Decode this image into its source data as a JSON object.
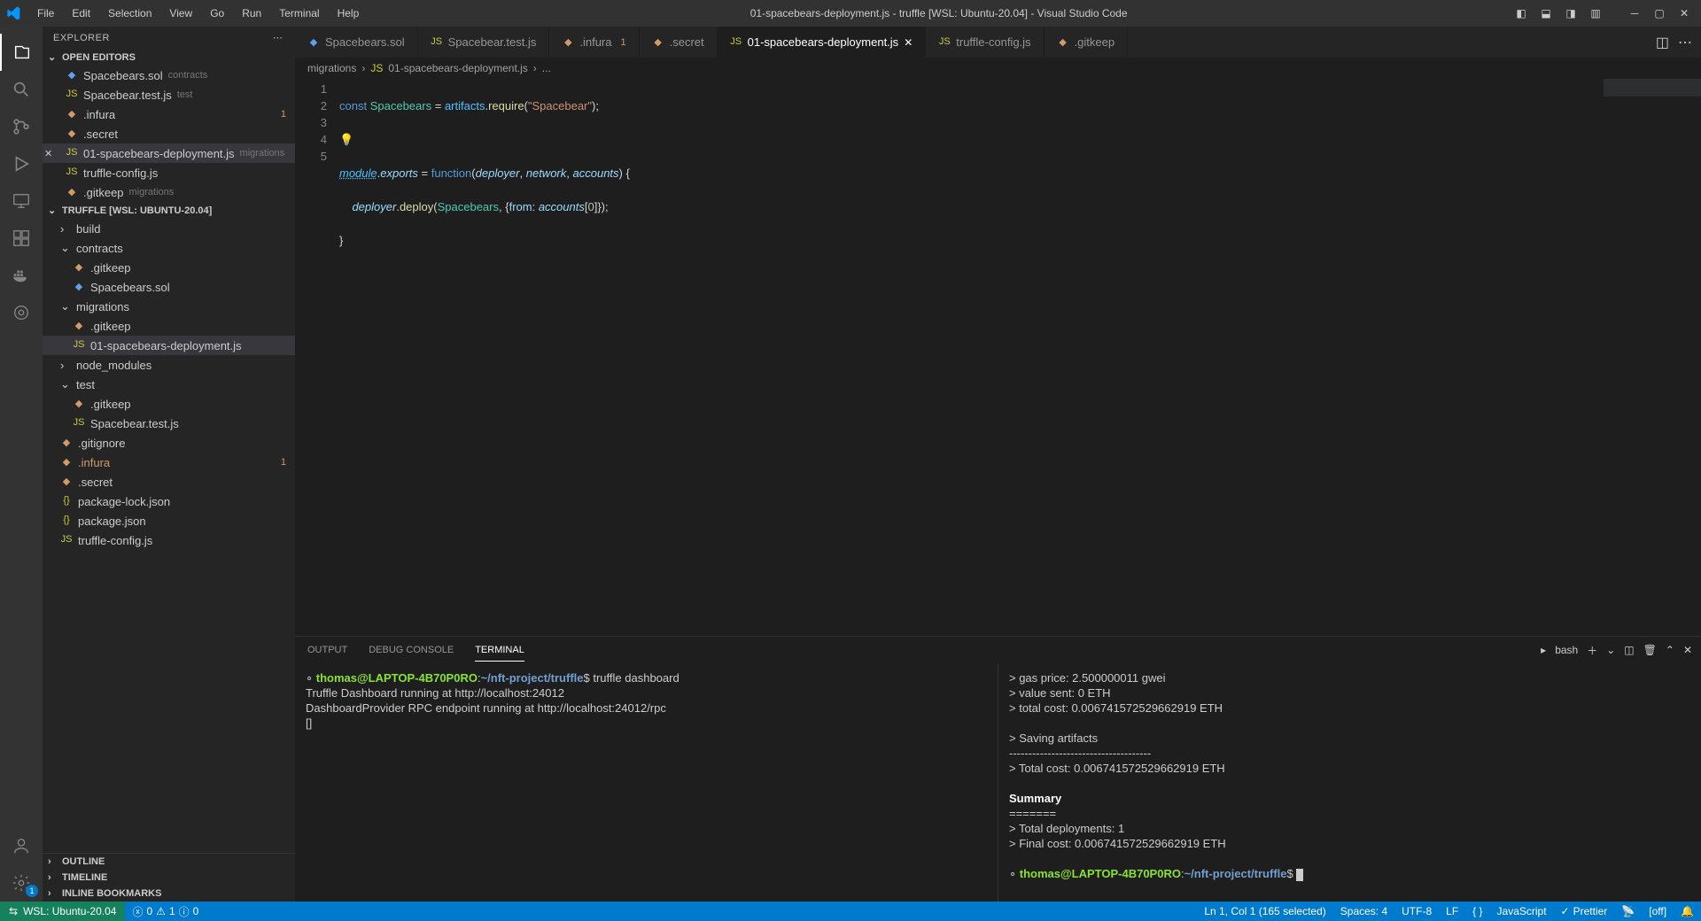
{
  "titlebar": {
    "menus": [
      "File",
      "Edit",
      "Selection",
      "View",
      "Go",
      "Run",
      "Terminal",
      "Help"
    ],
    "title": "01-spacebears-deployment.js - truffle [WSL: Ubuntu-20.04] - Visual Studio Code"
  },
  "sidebar": {
    "header": "EXPLORER",
    "open_editors_label": "OPEN EDITORS",
    "open_editors": [
      {
        "name": "Spacebears.sol",
        "hint": "contracts",
        "icon": "sol"
      },
      {
        "name": "Spacebear.test.js",
        "hint": "test",
        "icon": "js"
      },
      {
        "name": ".infura",
        "hint": "",
        "icon": "mod",
        "badge": "1"
      },
      {
        "name": ".secret",
        "hint": "",
        "icon": "mod"
      },
      {
        "name": "01-spacebears-deployment.js",
        "hint": "migrations",
        "icon": "js",
        "close": true,
        "sel": true
      },
      {
        "name": "truffle-config.js",
        "hint": "",
        "icon": "js"
      },
      {
        "name": ".gitkeep",
        "hint": "migrations",
        "icon": "mod"
      }
    ],
    "workspace_label": "TRUFFLE [WSL: UBUNTU-20.04]",
    "tree": [
      {
        "t": "folder",
        "name": "build",
        "depth": 1,
        "open": false
      },
      {
        "t": "folder",
        "name": "contracts",
        "depth": 1,
        "open": true
      },
      {
        "t": "file",
        "name": ".gitkeep",
        "depth": 2,
        "icon": "mod"
      },
      {
        "t": "file",
        "name": "Spacebears.sol",
        "depth": 2,
        "icon": "sol"
      },
      {
        "t": "folder",
        "name": "migrations",
        "depth": 1,
        "open": true
      },
      {
        "t": "file",
        "name": ".gitkeep",
        "depth": 2,
        "icon": "mod"
      },
      {
        "t": "file",
        "name": "01-spacebears-deployment.js",
        "depth": 2,
        "icon": "js",
        "sel": true
      },
      {
        "t": "folder",
        "name": "node_modules",
        "depth": 1,
        "open": false
      },
      {
        "t": "folder",
        "name": "test",
        "depth": 1,
        "open": true
      },
      {
        "t": "file",
        "name": ".gitkeep",
        "depth": 2,
        "icon": "mod"
      },
      {
        "t": "file",
        "name": "Spacebear.test.js",
        "depth": 2,
        "icon": "js"
      },
      {
        "t": "file",
        "name": ".gitignore",
        "depth": 1,
        "icon": "mod"
      },
      {
        "t": "file",
        "name": ".infura",
        "depth": 1,
        "icon": "mod",
        "badge": "1",
        "modc": true
      },
      {
        "t": "file",
        "name": ".secret",
        "depth": 1,
        "icon": "mod"
      },
      {
        "t": "file",
        "name": "package-lock.json",
        "depth": 1,
        "icon": "json"
      },
      {
        "t": "file",
        "name": "package.json",
        "depth": 1,
        "icon": "json"
      },
      {
        "t": "file",
        "name": "truffle-config.js",
        "depth": 1,
        "icon": "js"
      }
    ],
    "outline": "OUTLINE",
    "timeline": "TIMELINE",
    "bookmarks": "INLINE BOOKMARKS"
  },
  "tabs": [
    {
      "name": "Spacebears.sol",
      "icon": "sol"
    },
    {
      "name": "Spacebear.test.js",
      "icon": "js"
    },
    {
      "name": ".infura",
      "icon": "mod",
      "warn": "1"
    },
    {
      "name": ".secret",
      "icon": "mod"
    },
    {
      "name": "01-spacebears-deployment.js",
      "icon": "js",
      "active": true,
      "close": true
    },
    {
      "name": "truffle-config.js",
      "icon": "js"
    },
    {
      "name": ".gitkeep",
      "icon": "mod"
    }
  ],
  "breadcrumbs": {
    "a": "migrations",
    "b": "01-spacebears-deployment.js",
    "c": "..."
  },
  "code": {
    "l1_a": "const",
    "l1_b": "Spacebears",
    "l1_c": "=",
    "l1_d": "artifacts",
    "l1_e": ".",
    "l1_f": "require",
    "l1_g": "(",
    "l1_h": "\"Spacebear\"",
    "l1_i": ");",
    "l3_a": "module",
    "l3_b": ".",
    "l3_c": "exports",
    "l3_d": " = ",
    "l3_e": "function",
    "l3_f": "(",
    "l3_g": "deployer",
    "l3_h": ", ",
    "l3_i": "network",
    "l3_j": ", ",
    "l3_k": "accounts",
    "l3_l": ") {",
    "l4_a": "    ",
    "l4_b": "deployer",
    "l4_c": ".",
    "l4_d": "deploy",
    "l4_e": "(",
    "l4_f": "Spacebears",
    "l4_g": ", {",
    "l4_h": "from",
    "l4_i": ": ",
    "l4_j": "accounts",
    "l4_k": "[",
    "l4_l": "0",
    "l4_m": "]});",
    "l5": "}"
  },
  "lines": [
    "1",
    "2",
    "3",
    "4",
    "5"
  ],
  "panel": {
    "tabs": [
      "OUTPUT",
      "DEBUG CONSOLE",
      "TERMINAL"
    ],
    "shell": "bash",
    "left": {
      "prompt_user": "thomas@LAPTOP-4B70P0RO",
      "prompt_sep": ":",
      "prompt_path": "~/nft-project/truffle",
      "prompt_end": "$",
      "cmd": "truffle dashboard",
      "l2": "Truffle Dashboard running at http://localhost:24012",
      "l3": "DashboardProvider RPC endpoint running at http://localhost:24012/rpc",
      "l4": "[]"
    },
    "right": {
      "r1": " > gas price:           2.500000011 gwei",
      "r2": " > value sent:          0 ETH",
      "r3": " > total cost:          0.006741572529662919 ETH",
      "r4": "",
      "r5": " > Saving artifacts",
      "r6": " -------------------------------------",
      "r7": " > Total cost:     0.006741572529662919 ETH",
      "r8": "",
      "sum": "Summary",
      "sep": "=======",
      "r9": "> Total deployments:   1",
      "r10": "> Final cost:          0.006741572529662919 ETH",
      "prompt_user": "thomas@LAPTOP-4B70P0RO",
      "prompt_path": "~/nft-project/truffle",
      "prompt_end": "$"
    }
  },
  "status": {
    "remote": "WSL: Ubuntu-20.04",
    "errors": "0",
    "warns": "1",
    "info": "0",
    "sel": "Ln 1, Col 1 (165 selected)",
    "spaces": "Spaces: 4",
    "enc": "UTF-8",
    "eol": "LF",
    "lang": "JavaScript",
    "prettier": "Prettier",
    "off": "[off]",
    "brackets": "{ }"
  }
}
